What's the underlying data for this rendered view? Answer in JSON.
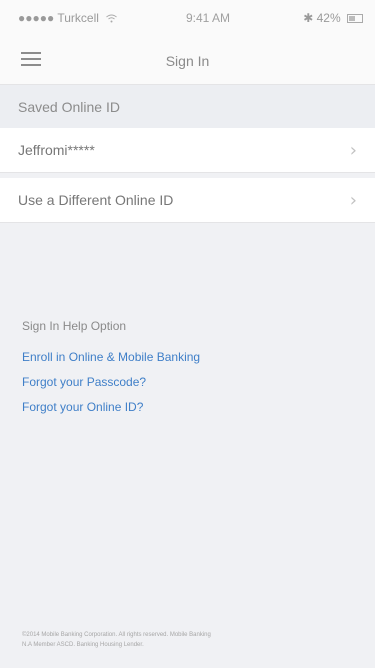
{
  "status_bar": {
    "carrier": "●●●●● Turkcell",
    "wifi_icon": "wifi-icon",
    "time": "9:41 AM",
    "bluetooth_icon": "bluetooth-icon",
    "battery": "42%"
  },
  "nav": {
    "title": "Sign In",
    "menu_icon": "hamburger-menu-icon"
  },
  "saved_section": {
    "header": "Saved Online ID",
    "saved_id": "Jeffromi*****"
  },
  "different_id": {
    "label": "Use a Different Online ID"
  },
  "help": {
    "title": "Sign In Help Option",
    "links": [
      "Enroll in Online & Mobile Banking",
      "Forgot your Passcode?",
      "Forgot your Online ID?"
    ]
  },
  "footer": {
    "line1": "©2014 Mobile Banking Corporation. All rights reserved. Mobile Banking",
    "line2": "N.A Member ASCD. Banking Housing Lender."
  },
  "colors": {
    "background": "#f0f1f4",
    "link": "#3f7fc8",
    "row_bg": "#ffffff"
  }
}
